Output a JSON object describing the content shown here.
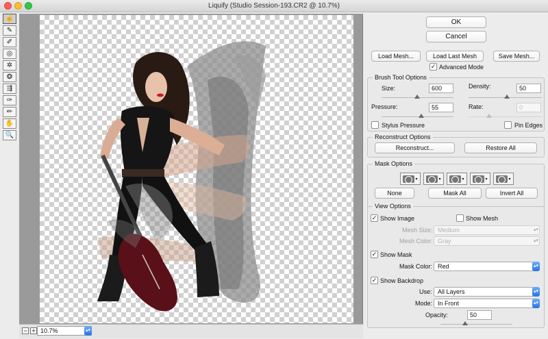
{
  "window": {
    "title": "Liquify (Studio Session-193.CR2 @ 10.7%)"
  },
  "tools": [
    {
      "icon": "forward-warp-icon",
      "glyph": "☝"
    },
    {
      "icon": "reconstruct-icon",
      "glyph": "✎"
    },
    {
      "icon": "smooth-icon",
      "glyph": "✐"
    },
    {
      "icon": "twirl-icon",
      "glyph": "◎"
    },
    {
      "icon": "pucker-icon",
      "glyph": "✲"
    },
    {
      "icon": "bloat-icon",
      "glyph": "❂"
    },
    {
      "icon": "push-left-icon",
      "glyph": "⇶"
    },
    {
      "icon": "freeze-mask-icon",
      "glyph": "✑"
    },
    {
      "icon": "thaw-mask-icon",
      "glyph": "✏"
    },
    {
      "icon": "hand-icon",
      "glyph": "✋"
    },
    {
      "icon": "zoom-icon",
      "glyph": "🔍"
    }
  ],
  "status": {
    "zoom_out": "−",
    "zoom_in": "+",
    "zoom_value": "10.7%"
  },
  "buttons": {
    "ok": "OK",
    "cancel": "Cancel",
    "load_mesh": "Load Mesh...",
    "load_last_mesh": "Load Last Mesh",
    "save_mesh": "Save Mesh..."
  },
  "advanced_mode": {
    "label": "Advanced Mode",
    "checked": true
  },
  "brush": {
    "title": "Brush Tool Options",
    "size_label": "Size:",
    "size": "600",
    "density_label": "Density:",
    "density": "50",
    "pressure_label": "Pressure:",
    "pressure": "55",
    "rate_label": "Rate:",
    "rate": "0",
    "stylus_label": "Stylus Pressure",
    "pin_label": "Pin Edges"
  },
  "reconstruct": {
    "title": "Reconstruct Options",
    "reconstruct_btn": "Reconstruct...",
    "restore_btn": "Restore All"
  },
  "mask": {
    "title": "Mask Options",
    "none_btn": "None",
    "mask_all_btn": "Mask All",
    "invert_btn": "Invert All"
  },
  "view": {
    "title": "View Options",
    "show_image": "Show Image",
    "show_mesh": "Show Mesh",
    "mesh_size_label": "Mesh Size:",
    "mesh_size": "Medium",
    "mesh_color_label": "Mesh Color:",
    "mesh_color": "Gray",
    "show_mask": "Show Mask",
    "mask_color_label": "Mask Color:",
    "mask_color": "Red",
    "show_backdrop": "Show Backdrop",
    "use_label": "Use:",
    "use": "All Layers",
    "mode_label": "Mode:",
    "mode": "In Front",
    "opacity_label": "Opacity:",
    "opacity": "50"
  }
}
